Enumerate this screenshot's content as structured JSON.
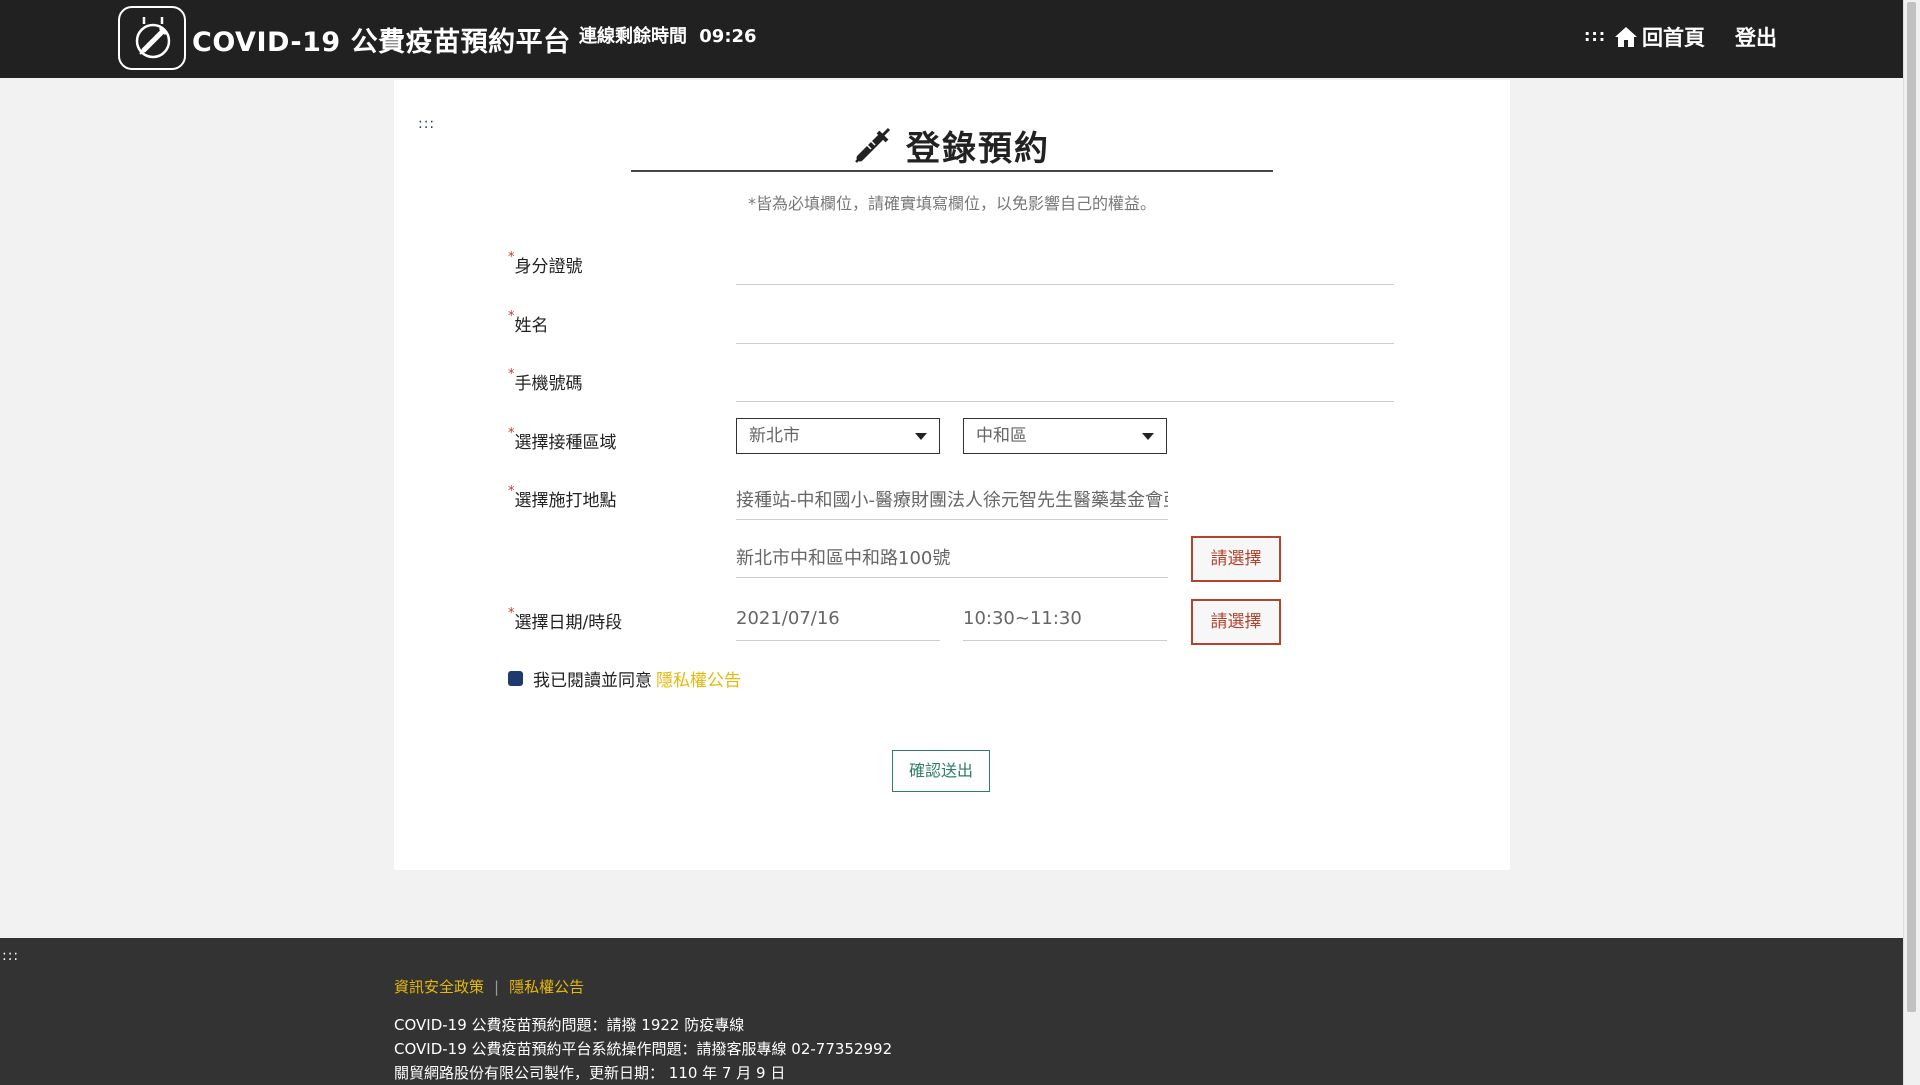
{
  "header": {
    "brand": "COVID-19 公費疫苗預約平台",
    "session_label": "連線剩餘時間",
    "session_time": "09:26",
    "nav_dots": ":::",
    "home_label": "回首頁",
    "logout_label": "登出"
  },
  "form": {
    "dots": ":::",
    "title": "登錄預約",
    "note": "*皆為必填欄位，請確實填寫欄位，以免影響自己的權益。",
    "required_mark": "*",
    "id_label": "身分證號",
    "name_label": "姓名",
    "phone_label": "手機號碼",
    "area_label": "選擇接種區域",
    "city_value": "新北市",
    "district_value": "中和區",
    "site_label": "選擇施打地點",
    "site_name": "接種站-中和國小-醫療財團法人徐元智先生醫藥基金會亞",
    "site_address": "新北市中和區中和路100號",
    "choose_label": "請選擇",
    "date_label": "選擇日期/時段",
    "date_value": "2021/07/16",
    "time_value": "10:30~11:30",
    "agree_text": "我已閱讀並同意",
    "privacy_link": "隱私權公告",
    "submit_label": "確認送出"
  },
  "footer": {
    "dots": ":::",
    "security_policy": "資訊安全政策",
    "separator": "|",
    "privacy": "隱私權公告",
    "line1": "COVID-19 公費疫苗預約問題：請撥 1922 防疫專線",
    "line2": "COVID-19 公費疫苗預約平台系統操作問題：請撥客服專線 02-77352992",
    "line3": "關貿網路股份有限公司製作，更新日期： 110 年 7 月 9 日"
  },
  "colors": {
    "header_bg": "#212121",
    "footer_bg": "#333333",
    "accent_red": "#b5422b",
    "accent_green": "#2e7d64",
    "link_yellow": "#e5b90c",
    "checkbox_blue": "#1f3a6e"
  }
}
